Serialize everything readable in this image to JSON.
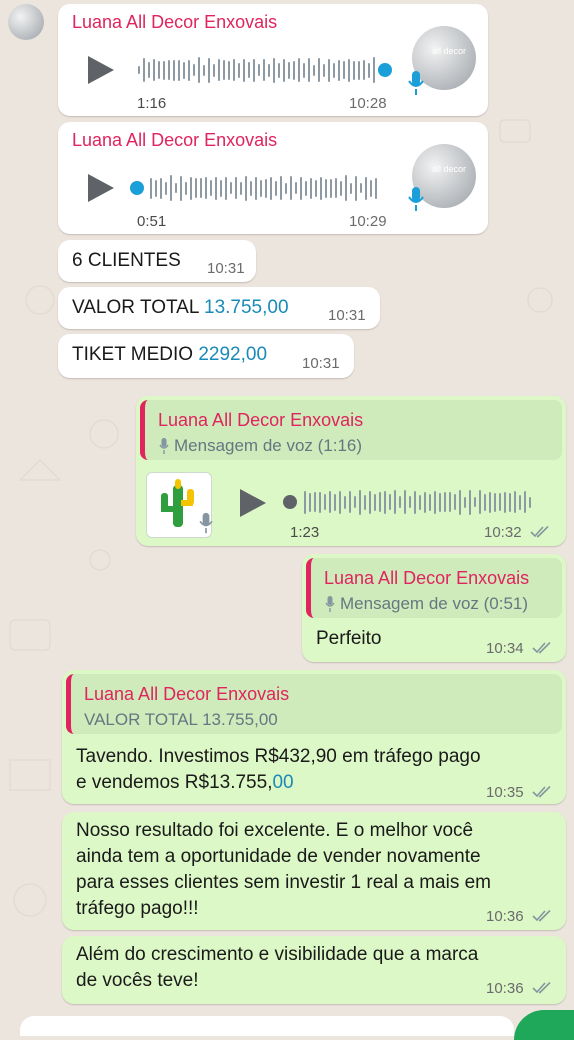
{
  "chat": {
    "messages": [
      {
        "type": "voice",
        "sender": "Luana All Decor Enxovais",
        "duration": "1:16",
        "time": "10:28",
        "avatar_text": "all decor"
      },
      {
        "type": "voice",
        "sender": "Luana All Decor Enxovais",
        "duration": "0:51",
        "time": "10:29",
        "avatar_text": "all decor"
      },
      {
        "type": "text",
        "text": "6 CLIENTES",
        "time": "10:31"
      },
      {
        "type": "text",
        "text_prefix": "VALOR TOTAL ",
        "text_link": "13.755,00",
        "time": "10:31"
      },
      {
        "type": "text",
        "text_prefix": "TIKET MEDIO ",
        "text_link": "2292,00",
        "time": "10:31"
      },
      {
        "type": "reply_voice",
        "quote_sender": "Luana All Decor Enxovais",
        "quote_text": "Mensagem de voz (1:16)",
        "duration": "1:23",
        "time": "10:32"
      },
      {
        "type": "reply_text",
        "quote_sender": "Luana All Decor Enxovais",
        "quote_text": "Mensagem de voz (0:51)",
        "text": "Perfeito",
        "time": "10:34"
      },
      {
        "type": "reply_text",
        "quote_sender": "Luana All Decor Enxovais",
        "quote_text": "VALOR TOTAL 13.755,00",
        "text_line1": "Tavendo. Investimos R$432,90 em tráfego pago",
        "text_line2_prefix": "e vendemos R$13.755,",
        "text_line2_link": "00",
        "time": "10:35"
      },
      {
        "type": "text",
        "lines": [
          "Nosso resultado foi excelente. E o melhor você",
          "ainda tem a oportunidade de vender novamente",
          "para esses clientes sem investir 1 real a mais em",
          "tráfego pago!!!"
        ],
        "time": "10:36"
      },
      {
        "type": "text",
        "lines": [
          "Além do crescimento e visibilidade que a marca",
          "de vocês teve!"
        ],
        "time": "10:36"
      }
    ]
  },
  "colors": {
    "background": "#ece5dd",
    "incoming": "#ffffff",
    "outgoing": "#dcf8c6",
    "sender": "#e0245e",
    "link": "#1a8ab8",
    "mic": "#1a9fd8",
    "read_ticks": "#8696a0"
  },
  "icons": {
    "play": "play-icon",
    "mic": "mic-icon",
    "ticks": "double-check-icon"
  }
}
